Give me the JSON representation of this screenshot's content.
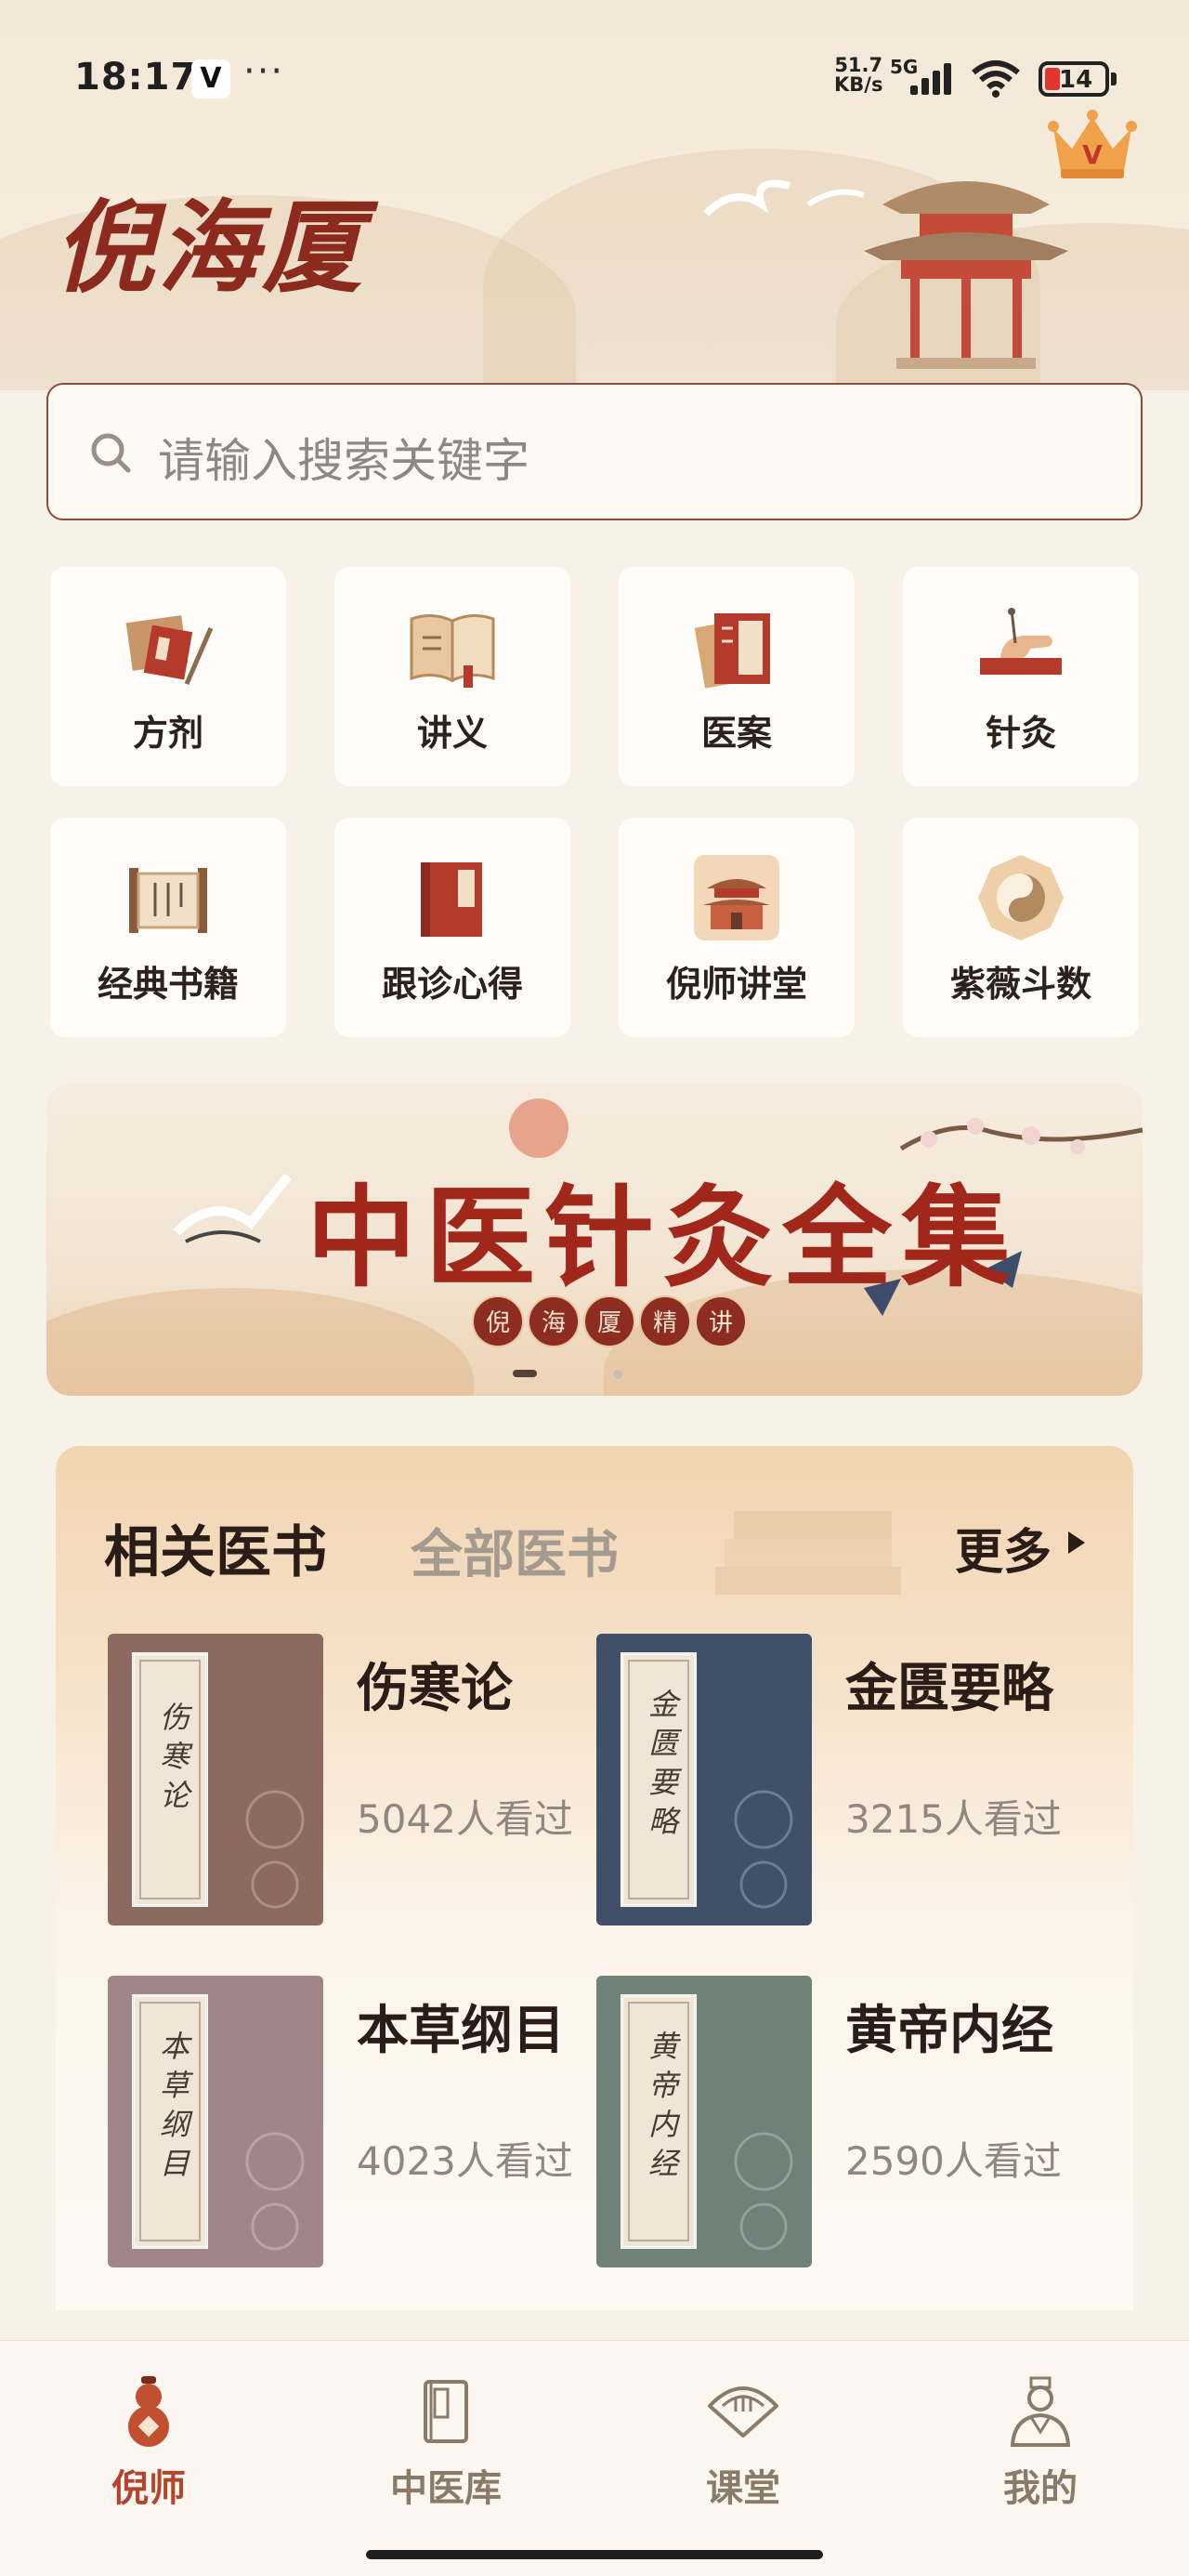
{
  "status_bar": {
    "time": "18:17",
    "app_badge": "V",
    "dots": "···",
    "net_speed_value": "51.7",
    "net_speed_unit": "KB/s",
    "network": "5G",
    "battery": "14",
    "battery_color": "#e3342f"
  },
  "header": {
    "brand_title": "倪海厦",
    "vip_badge": "V"
  },
  "search": {
    "placeholder": "请输入搜索关键字",
    "icon": "search-icon"
  },
  "grid": {
    "items": [
      {
        "label": "方剂",
        "icon": "prescription-scroll-icon"
      },
      {
        "label": "讲义",
        "icon": "open-book-icon"
      },
      {
        "label": "医案",
        "icon": "medical-record-icon"
      },
      {
        "label": "针灸",
        "icon": "acupuncture-hand-icon"
      },
      {
        "label": "经典书籍",
        "icon": "classic-scroll-icon"
      },
      {
        "label": "跟诊心得",
        "icon": "red-book-icon"
      },
      {
        "label": "倪师讲堂",
        "icon": "lecture-hall-icon"
      },
      {
        "label": "紫薇斗数",
        "icon": "yin-yang-icon"
      }
    ]
  },
  "banner": {
    "title": "中医针灸全集",
    "subtitle": [
      "倪",
      "海",
      "厦",
      "精",
      "讲"
    ],
    "page_count": 2,
    "active_page": 1
  },
  "books": {
    "tab_active": "相关医书",
    "tab_inactive": "全部医书",
    "more": "更多",
    "items": [
      {
        "title": "伤寒论",
        "cover_text": "伤寒论",
        "views": "5042人看过",
        "cover_color": "#8c6a5f"
      },
      {
        "title": "金匮要略",
        "cover_text": "金匮要略",
        "views": "3215人看过",
        "cover_color": "#3f5068"
      },
      {
        "title": "本草纲目",
        "cover_text": "本草纲目",
        "views": "4023人看过",
        "cover_color": "#a08688"
      },
      {
        "title": "黄帝内经",
        "cover_text": "黄帝内经",
        "views": "2590人看过",
        "cover_color": "#6f8179"
      }
    ]
  },
  "bottom_nav": {
    "items": [
      {
        "label": "倪师",
        "icon": "gourd-icon",
        "active": true
      },
      {
        "label": "中医库",
        "icon": "book-library-icon",
        "active": false
      },
      {
        "label": "课堂",
        "icon": "fan-icon",
        "active": false
      },
      {
        "label": "我的",
        "icon": "scholar-icon",
        "active": false
      }
    ],
    "active_color": "#b2452e"
  }
}
